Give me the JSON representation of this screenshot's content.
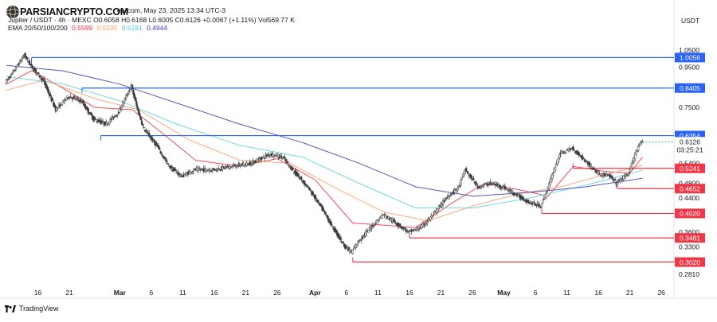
{
  "watermark": {
    "text": "PARSIANCRYPTO.COM",
    "icon": "logo-sphere-icon"
  },
  "header": {
    "source_fragment": "ew.com, May 23, 2025 13:34 UTC-3",
    "symbol": "Jupiter / USDT · 4h · MEXC",
    "open": "O0.6058",
    "high": "H0.6168",
    "low": "L0.6005",
    "close": "C0.6126",
    "change": "+0.0067 (+1.11%)",
    "volume": "Vol569.77 K",
    "ema_label": "EMA 20/50/100/200",
    "ema_values": [
      "0.5599",
      "0.5335",
      "0.5181",
      "0.4944"
    ]
  },
  "currency": "USDT",
  "brand": {
    "label": "TradingView",
    "icon": "tradingview-logo-icon"
  },
  "colors": {
    "up": "#089981",
    "down": "#f23645",
    "candle": "#3d3d3d",
    "ema20": "#f23645",
    "ema50": "#ff9f70",
    "ema100": "#5fd3e0",
    "ema200": "#3f45b8",
    "resistance": "#2962ff",
    "support": "#f23645",
    "price_tag": "#1e1e1e"
  },
  "chart_data": {
    "type": "candlestick",
    "title": "Jupiter / USDT · 4h · MEXC",
    "ylabel": "USDT",
    "y_scale": "log",
    "ylim": [
      0.262,
      1.17
    ],
    "xlim": [
      "2025-02-11",
      "2025-05-28"
    ],
    "x_ticks": [
      {
        "label": "16",
        "date": "2025-02-16"
      },
      {
        "label": "21",
        "date": "2025-02-21"
      },
      {
        "label": "Mar",
        "date": "2025-03-01",
        "bold": true
      },
      {
        "label": "6",
        "date": "2025-03-06"
      },
      {
        "label": "11",
        "date": "2025-03-11"
      },
      {
        "label": "16",
        "date": "2025-03-16"
      },
      {
        "label": "21",
        "date": "2025-03-21"
      },
      {
        "label": "26",
        "date": "2025-03-26"
      },
      {
        "label": "Apr",
        "date": "2025-04-01",
        "bold": true
      },
      {
        "label": "6",
        "date": "2025-04-06"
      },
      {
        "label": "11",
        "date": "2025-04-11"
      },
      {
        "label": "16",
        "date": "2025-04-16"
      },
      {
        "label": "21",
        "date": "2025-04-21"
      },
      {
        "label": "26",
        "date": "2025-04-26"
      },
      {
        "label": "May",
        "date": "2025-05-01",
        "bold": true
      },
      {
        "label": "6",
        "date": "2025-05-06"
      },
      {
        "label": "11",
        "date": "2025-05-11"
      },
      {
        "label": "16",
        "date": "2025-05-16"
      },
      {
        "label": "21",
        "date": "2025-05-21"
      },
      {
        "label": "26",
        "date": "2025-05-26"
      }
    ],
    "y_ticks": [
      "1.0500",
      "0.9500",
      "0.7500",
      "0.5400",
      "0.4800",
      "0.4400",
      "0.3600",
      "0.3300",
      "0.2810"
    ],
    "price_path": [
      {
        "date": "2025-02-11",
        "price": 0.87
      },
      {
        "date": "2025-02-12",
        "price": 0.91
      },
      {
        "date": "2025-02-14",
        "price": 1.02
      },
      {
        "date": "2025-02-15",
        "price": 0.96
      },
      {
        "date": "2025-02-17",
        "price": 0.88
      },
      {
        "date": "2025-02-19",
        "price": 0.74
      },
      {
        "date": "2025-02-21",
        "price": 0.8
      },
      {
        "date": "2025-02-23",
        "price": 0.78
      },
      {
        "date": "2025-02-25",
        "price": 0.7
      },
      {
        "date": "2025-02-27",
        "price": 0.68
      },
      {
        "date": "2025-03-01",
        "price": 0.73
      },
      {
        "date": "2025-03-03",
        "price": 0.85
      },
      {
        "date": "2025-03-04",
        "price": 0.74
      },
      {
        "date": "2025-03-05",
        "price": 0.66
      },
      {
        "date": "2025-03-07",
        "price": 0.6
      },
      {
        "date": "2025-03-09",
        "price": 0.53
      },
      {
        "date": "2025-03-11",
        "price": 0.5
      },
      {
        "date": "2025-03-13",
        "price": 0.52
      },
      {
        "date": "2025-03-16",
        "price": 0.52
      },
      {
        "date": "2025-03-19",
        "price": 0.53
      },
      {
        "date": "2025-03-22",
        "price": 0.54
      },
      {
        "date": "2025-03-25",
        "price": 0.57
      },
      {
        "date": "2025-03-27",
        "price": 0.56
      },
      {
        "date": "2025-03-29",
        "price": 0.51
      },
      {
        "date": "2025-03-31",
        "price": 0.47
      },
      {
        "date": "2025-04-02",
        "price": 0.42
      },
      {
        "date": "2025-04-04",
        "price": 0.37
      },
      {
        "date": "2025-04-06",
        "price": 0.33
      },
      {
        "date": "2025-04-07",
        "price": 0.32
      },
      {
        "date": "2025-04-08",
        "price": 0.34
      },
      {
        "date": "2025-04-10",
        "price": 0.37
      },
      {
        "date": "2025-04-12",
        "price": 0.4
      },
      {
        "date": "2025-04-14",
        "price": 0.38
      },
      {
        "date": "2025-04-16",
        "price": 0.36
      },
      {
        "date": "2025-04-18",
        "price": 0.37
      },
      {
        "date": "2025-04-20",
        "price": 0.4
      },
      {
        "date": "2025-04-22",
        "price": 0.44
      },
      {
        "date": "2025-04-24",
        "price": 0.47
      },
      {
        "date": "2025-04-25",
        "price": 0.52
      },
      {
        "date": "2025-04-27",
        "price": 0.47
      },
      {
        "date": "2025-04-29",
        "price": 0.48
      },
      {
        "date": "2025-05-01",
        "price": 0.47
      },
      {
        "date": "2025-05-03",
        "price": 0.45
      },
      {
        "date": "2025-05-05",
        "price": 0.43
      },
      {
        "date": "2025-05-07",
        "price": 0.42
      },
      {
        "date": "2025-05-08",
        "price": 0.46
      },
      {
        "date": "2025-05-10",
        "price": 0.57
      },
      {
        "date": "2025-05-12",
        "price": 0.59
      },
      {
        "date": "2025-05-14",
        "price": 0.55
      },
      {
        "date": "2025-05-16",
        "price": 0.51
      },
      {
        "date": "2025-05-18",
        "price": 0.5
      },
      {
        "date": "2025-05-19",
        "price": 0.48
      },
      {
        "date": "2025-05-21",
        "price": 0.51
      },
      {
        "date": "2025-05-22",
        "price": 0.57
      },
      {
        "date": "2025-05-23",
        "price": 0.6126
      }
    ],
    "ema_series": [
      {
        "name": "EMA 20",
        "color": "#f23645",
        "points": [
          {
            "date": "2025-02-11",
            "price": 0.86
          },
          {
            "date": "2025-02-15",
            "price": 0.93
          },
          {
            "date": "2025-02-20",
            "price": 0.84
          },
          {
            "date": "2025-02-25",
            "price": 0.75
          },
          {
            "date": "2025-03-03",
            "price": 0.74
          },
          {
            "date": "2025-03-08",
            "price": 0.64
          },
          {
            "date": "2025-03-13",
            "price": 0.55
          },
          {
            "date": "2025-03-20",
            "price": 0.53
          },
          {
            "date": "2025-03-26",
            "price": 0.555
          },
          {
            "date": "2025-04-01",
            "price": 0.49
          },
          {
            "date": "2025-04-07",
            "price": 0.38
          },
          {
            "date": "2025-04-12",
            "price": 0.375
          },
          {
            "date": "2025-04-17",
            "price": 0.37
          },
          {
            "date": "2025-04-23",
            "price": 0.43
          },
          {
            "date": "2025-04-28",
            "price": 0.48
          },
          {
            "date": "2025-05-04",
            "price": 0.46
          },
          {
            "date": "2025-05-08",
            "price": 0.445
          },
          {
            "date": "2025-05-12",
            "price": 0.53
          },
          {
            "date": "2025-05-17",
            "price": 0.515
          },
          {
            "date": "2025-05-21",
            "price": 0.51
          },
          {
            "date": "2025-05-23",
            "price": 0.5599
          }
        ]
      },
      {
        "name": "EMA 50",
        "color": "#ff9f70",
        "points": [
          {
            "date": "2025-02-11",
            "price": 0.83
          },
          {
            "date": "2025-02-17",
            "price": 0.88
          },
          {
            "date": "2025-02-25",
            "price": 0.79
          },
          {
            "date": "2025-03-04",
            "price": 0.74
          },
          {
            "date": "2025-03-12",
            "price": 0.62
          },
          {
            "date": "2025-03-20",
            "price": 0.55
          },
          {
            "date": "2025-03-28",
            "price": 0.54
          },
          {
            "date": "2025-04-05",
            "price": 0.46
          },
          {
            "date": "2025-04-12",
            "price": 0.405
          },
          {
            "date": "2025-04-19",
            "price": 0.385
          },
          {
            "date": "2025-04-26",
            "price": 0.42
          },
          {
            "date": "2025-05-03",
            "price": 0.45
          },
          {
            "date": "2025-05-10",
            "price": 0.47
          },
          {
            "date": "2025-05-17",
            "price": 0.505
          },
          {
            "date": "2025-05-23",
            "price": 0.5335
          }
        ]
      },
      {
        "name": "EMA 100",
        "color": "#5fd3e0",
        "points": [
          {
            "date": "2025-02-11",
            "price": 0.9
          },
          {
            "date": "2025-02-20",
            "price": 0.86
          },
          {
            "date": "2025-03-01",
            "price": 0.78
          },
          {
            "date": "2025-03-10",
            "price": 0.68
          },
          {
            "date": "2025-03-20",
            "price": 0.6
          },
          {
            "date": "2025-03-30",
            "price": 0.56
          },
          {
            "date": "2025-04-08",
            "price": 0.48
          },
          {
            "date": "2025-04-17",
            "price": 0.415
          },
          {
            "date": "2025-04-26",
            "price": 0.415
          },
          {
            "date": "2025-05-05",
            "price": 0.44
          },
          {
            "date": "2025-05-14",
            "price": 0.475
          },
          {
            "date": "2025-05-23",
            "price": 0.5181
          }
        ]
      },
      {
        "name": "EMA 200",
        "color": "#3f45b8",
        "points": [
          {
            "date": "2025-02-11",
            "price": 0.96
          },
          {
            "date": "2025-02-20",
            "price": 0.93
          },
          {
            "date": "2025-03-01",
            "price": 0.86
          },
          {
            "date": "2025-03-10",
            "price": 0.77
          },
          {
            "date": "2025-03-20",
            "price": 0.68
          },
          {
            "date": "2025-03-30",
            "price": 0.61
          },
          {
            "date": "2025-04-08",
            "price": 0.54
          },
          {
            "date": "2025-04-17",
            "price": 0.47
          },
          {
            "date": "2025-04-26",
            "price": 0.445
          },
          {
            "date": "2025-05-05",
            "price": 0.455
          },
          {
            "date": "2025-05-14",
            "price": 0.47
          },
          {
            "date": "2025-05-23",
            "price": 0.4944
          }
        ]
      }
    ],
    "resistance_levels": [
      {
        "value": 1.0056,
        "label": "1.0056",
        "from": "2025-02-15"
      },
      {
        "value": 0.8405,
        "label": "0.8405",
        "from": "2025-02-23"
      },
      {
        "value": 0.6354,
        "label": "0.6354",
        "from": "2025-02-26"
      }
    ],
    "support_levels": [
      {
        "value": 0.5241,
        "label": "0.5241",
        "from": "2025-05-12"
      },
      {
        "value": 0.4652,
        "label": "0.4652",
        "from": "2025-05-19"
      },
      {
        "value": 0.402,
        "label": "0.4020",
        "from": "2025-05-07"
      },
      {
        "value": 0.3481,
        "label": "0.3481",
        "from": "2025-04-16"
      },
      {
        "value": 0.302,
        "label": "0.3020",
        "from": "2025-04-07"
      }
    ],
    "current_price": {
      "value": 0.6126,
      "label": "0.6126",
      "countdown": "03:25:21"
    }
  }
}
